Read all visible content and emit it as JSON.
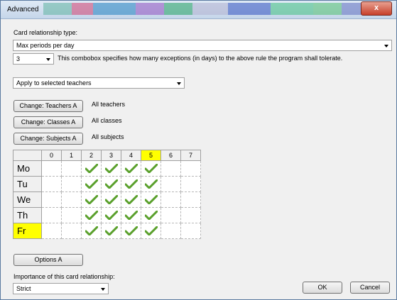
{
  "window": {
    "title": "Advanced",
    "close_label": "x"
  },
  "relationship": {
    "label": "Card relationship type:",
    "selected": "Max periods per day",
    "exceptions_value": "3",
    "exceptions_text": "This combobox specifies how many exceptions (in days) to the above rule the program shall tolerate.",
    "apply_to": "Apply to selected teachers"
  },
  "changes": [
    {
      "button": "Change: Teachers A",
      "value": "All teachers"
    },
    {
      "button": "Change: Classes A",
      "value": "All classes"
    },
    {
      "button": "Change: Subjects A",
      "value": "All subjects"
    }
  ],
  "grid": {
    "columns": [
      "0",
      "1",
      "2",
      "3",
      "4",
      "5",
      "6",
      "7"
    ],
    "highlight_column": "5",
    "rows": [
      {
        "label": "Mo",
        "checked": [
          2,
          3,
          4,
          5
        ],
        "highlight": false
      },
      {
        "label": "Tu",
        "checked": [
          2,
          3,
          4,
          5
        ],
        "highlight": false
      },
      {
        "label": "We",
        "checked": [
          2,
          3,
          4,
          5
        ],
        "highlight": false
      },
      {
        "label": "Th",
        "checked": [
          2,
          3,
          4,
          5
        ],
        "highlight": false
      },
      {
        "label": "Fr",
        "checked": [
          2,
          3,
          4,
          5
        ],
        "highlight": true
      }
    ],
    "check_icon": "checkmark-icon",
    "check_color": "#5aa02c"
  },
  "options_label": "Options A",
  "importance": {
    "label": "Importance of this card relationship:",
    "selected": "Strict"
  },
  "buttons": {
    "ok": "OK",
    "cancel": "Cancel"
  }
}
